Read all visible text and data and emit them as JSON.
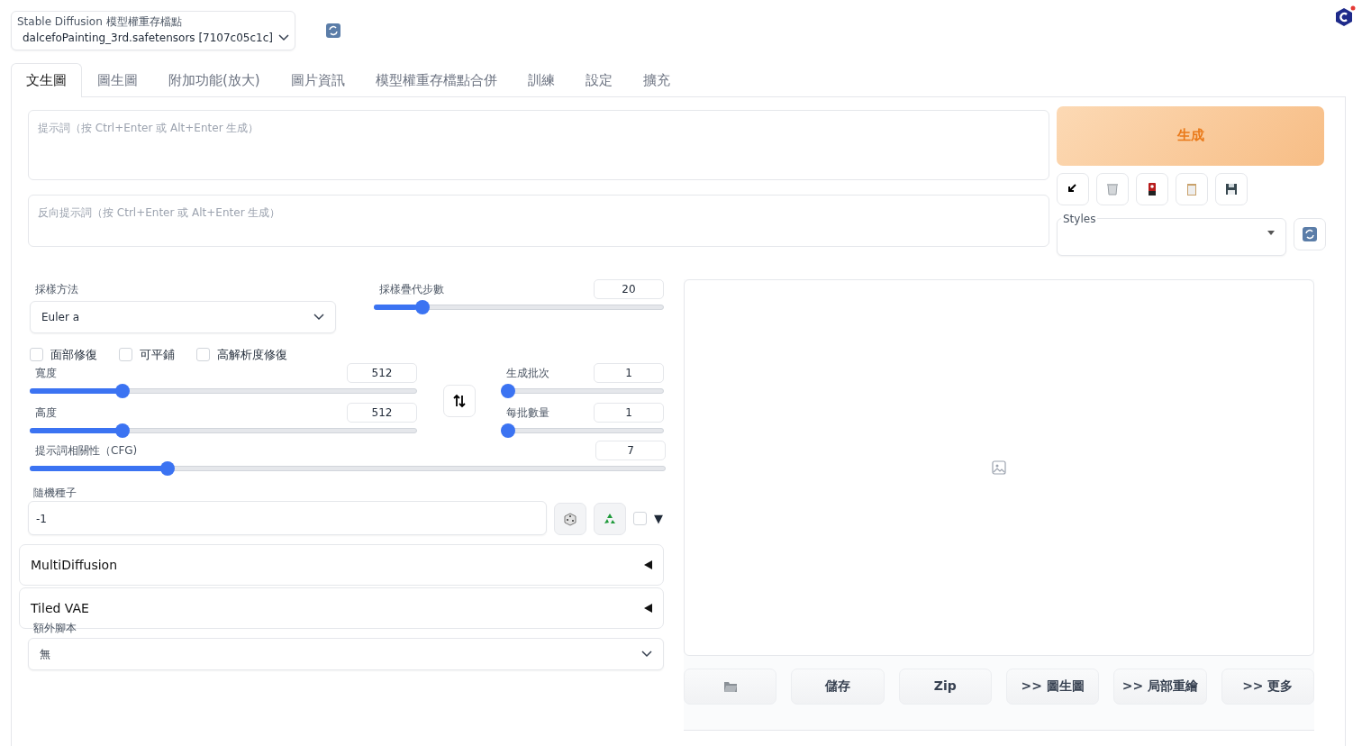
{
  "model_checkpoint": {
    "label": "Stable Diffusion 模型權重存檔點",
    "value": "dalcefoPainting_3rd.safetensors [7107c05c1c]"
  },
  "tabs": [
    {
      "label": "文生圖",
      "selected": true
    },
    {
      "label": "圖生圖",
      "selected": false
    },
    {
      "label": "附加功能(放大)",
      "selected": false
    },
    {
      "label": "圖片資訊",
      "selected": false
    },
    {
      "label": "模型權重存檔點合併",
      "selected": false
    },
    {
      "label": "訓練",
      "selected": false
    },
    {
      "label": "設定",
      "selected": false
    },
    {
      "label": "擴充",
      "selected": false
    }
  ],
  "prompt": {
    "placeholder": "提示詞（按 Ctrl+Enter 或 Alt+Enter 生成）"
  },
  "negative_prompt": {
    "placeholder": "反向提示詞（按 Ctrl+Enter 或 Alt+Enter 生成）"
  },
  "generate_button": "生成",
  "styles": {
    "label": "Styles"
  },
  "sampler": {
    "label": "採樣方法",
    "value": "Euler a"
  },
  "steps": {
    "label": "採樣疊代步數",
    "value": "20",
    "level": 0.15
  },
  "checkboxes": [
    {
      "label": "面部修復",
      "checked": false
    },
    {
      "label": "可平鋪",
      "checked": false
    },
    {
      "label": "高解析度修復",
      "checked": false
    }
  ],
  "size_sliders": [
    {
      "label": "寬度",
      "value": "512",
      "level": 0.23
    },
    {
      "label": "高度",
      "value": "512",
      "level": 0.23
    }
  ],
  "batch_sliders": [
    {
      "label": "生成批次",
      "value": "1",
      "level": 0
    },
    {
      "label": "每批數量",
      "value": "1",
      "level": 0
    }
  ],
  "cfg": {
    "label": "提示詞相關性（CFG)",
    "value": "7",
    "level": 0.21
  },
  "seed": {
    "label": "隨機種子",
    "value": "-1",
    "extra_checked": false,
    "extra_toggle": "▼"
  },
  "accordions": [
    {
      "title": "MultiDiffusion",
      "expanded": false
    },
    {
      "title": "Tiled VAE",
      "expanded": false
    }
  ],
  "script": {
    "label": "額外腳本",
    "value": "無"
  },
  "gallery_buttons": [
    "儲存",
    "Zip",
    ">> 圖生圖",
    ">> 局部重繪",
    ">> 更多"
  ]
}
